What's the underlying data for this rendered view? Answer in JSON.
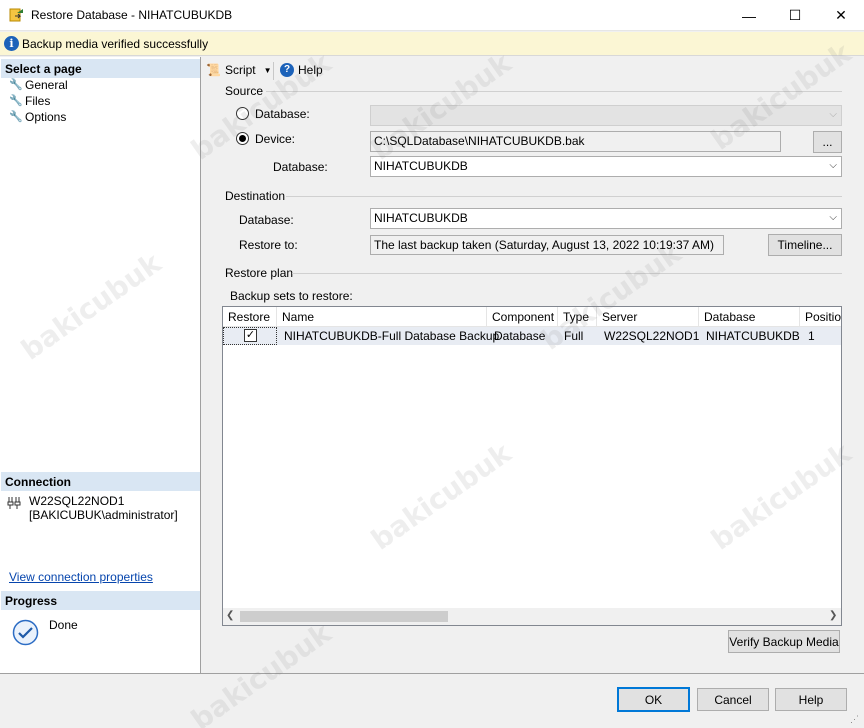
{
  "window": {
    "title": "Restore Database - NIHATCUBUKDB",
    "minimize": "—",
    "maximize": "☐",
    "close": "✕"
  },
  "infobar": {
    "message": "Backup media verified successfully"
  },
  "left": {
    "select_page": "Select a page",
    "pages": [
      "General",
      "Files",
      "Options"
    ],
    "connection_header": "Connection",
    "server": "W22SQL22NOD1",
    "user": "[BAKICUBUK\\administrator]",
    "view_connection": "View connection properties",
    "progress_header": "Progress",
    "progress_status": "Done"
  },
  "toolbar": {
    "script": "Script",
    "help": "Help"
  },
  "source": {
    "group": "Source",
    "database_radio": "Database:",
    "device_radio": "Device:",
    "device_path": "C:\\SQLDatabase\\NIHATCUBUKDB.bak",
    "browse": "...",
    "database_label": "Database:",
    "database_value": "NIHATCUBUKDB"
  },
  "destination": {
    "group": "Destination",
    "database_label": "Database:",
    "database_value": "NIHATCUBUKDB",
    "restore_to_label": "Restore to:",
    "restore_to_value": "The last backup taken (Saturday, August 13, 2022 10:19:37 AM)",
    "timeline": "Timeline..."
  },
  "plan": {
    "group": "Restore plan",
    "sets_label": "Backup sets to restore:",
    "columns": [
      "Restore",
      "Name",
      "Component",
      "Type",
      "Server",
      "Database",
      "Position"
    ],
    "rows": [
      {
        "restore": true,
        "name": "NIHATCUBUKDB-Full Database Backup",
        "component": "Database",
        "type": "Full",
        "server": "W22SQL22NOD1",
        "database": "NIHATCUBUKDB",
        "position": "1"
      }
    ],
    "verify": "Verify Backup Media"
  },
  "footer": {
    "ok": "OK",
    "cancel": "Cancel",
    "help": "Help"
  },
  "colors": {
    "accent": "#0078d7",
    "info_bg": "#fbf6d4",
    "section_bg": "#d9e6f3",
    "link": "#0645ad"
  },
  "watermark": "bakicubuk"
}
